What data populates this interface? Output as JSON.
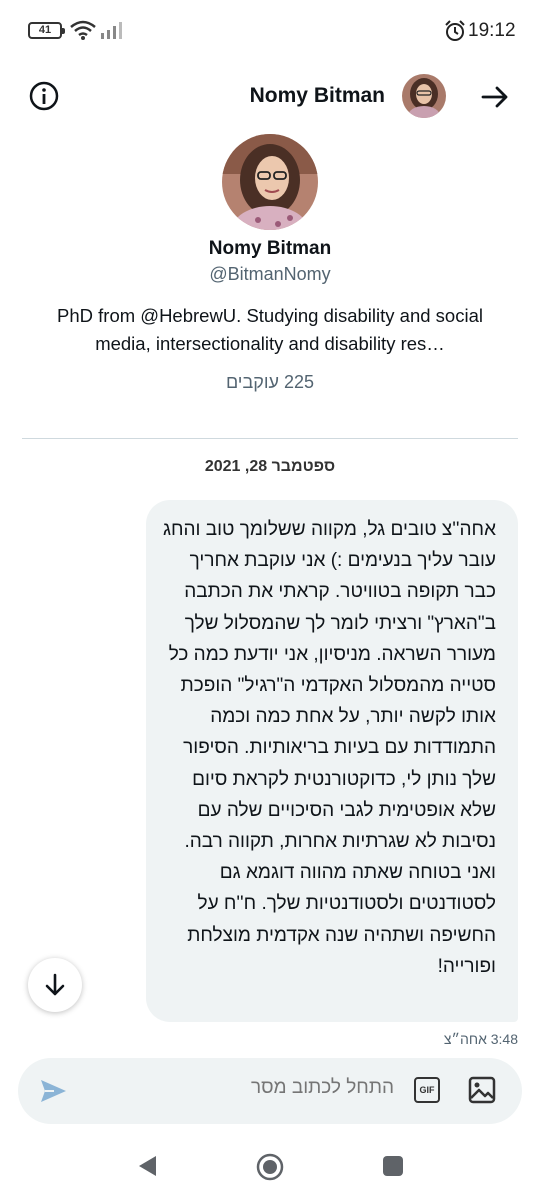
{
  "status_bar": {
    "battery": "41",
    "time": "19:12",
    "icons": [
      "wifi-icon",
      "signal-icon",
      "alarm-icon"
    ]
  },
  "header": {
    "title": "Nomy Bitman",
    "info_icon": "info-icon",
    "back_icon": "arrow-right-icon"
  },
  "profile": {
    "name": "Nomy Bitman",
    "handle": "@BitmanNomy",
    "bio": "PhD from @HebrewU. Studying disability and social media, intersectionality and disability res…",
    "followers_count": "225",
    "followers_label": "עוקבים"
  },
  "conversation": {
    "date_separator": "ספטמבר 28, 2021",
    "messages": [
      {
        "text": "אחה''צ טובים גל, מקווה ששלומך טוב והחג עובר עליך בנעימים :) אני עוקבת אחריך כבר תקופה בטוויטר. קראתי את הכתבה ב\"הארץ\" ורציתי לומר לך שהמסלול שלך מעורר השראה. מניסיון, אני יודעת כמה כל סטייה מהמסלול האקדמי ה\"רגיל\" הופכת אותו לקשה יותר, על אחת כמה וכמה התמודדות עם בעיות בריאותיות. הסיפור שלך נותן לי, כדוקטורנטית לקראת סיום שלא אופטימית לגבי הסיכויים שלה עם נסיבות לא שגרתיות אחרות, תקווה רבה. ואני בטוחה שאתה מהווה דוגמא גם לסטודנטים ולסטודנטיות שלך. ח''ח על החשיפה ושתהיה שנה אקדמית מוצלחת ופורייה!",
        "time": "3:48 אחה״צ"
      }
    ]
  },
  "composer": {
    "placeholder": "התחל לכתוב מסר",
    "gif_label": "GIF"
  },
  "colors": {
    "bubble_bg": "#eff3f4",
    "secondary_text": "#536471",
    "divider": "#cfd9de"
  }
}
